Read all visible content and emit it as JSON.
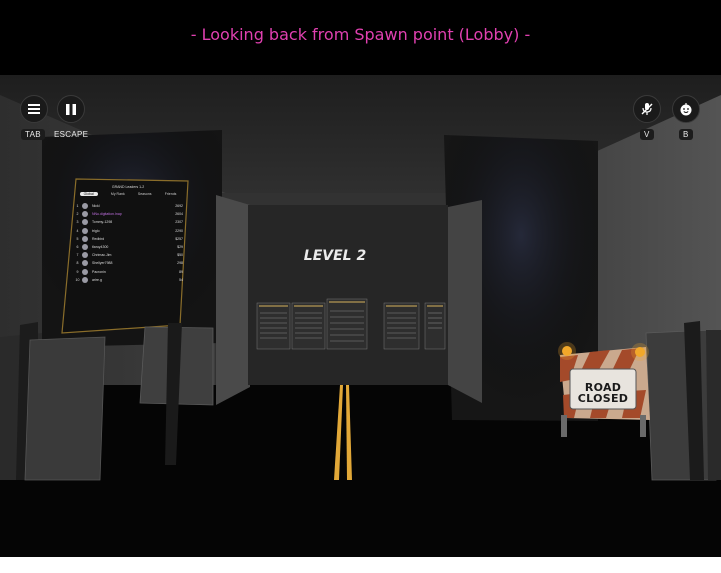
{
  "caption": "- Looking back from Spawn point (Lobby) -",
  "hud": {
    "menu_key": "TAB",
    "pause_key": "ESCAPE",
    "mic_key": "V",
    "emote_key": "B"
  },
  "level_sign": "LEVEL 2",
  "leaderboard": {
    "title": "GRAND Leaders 1-2",
    "tabs": [
      "Global",
      "My Rank",
      "Seasons",
      "Friends"
    ],
    "rows": [
      {
        "rank": "1",
        "name": "Nickl",
        "score": "2692"
      },
      {
        "rank": "2",
        "name": "NNu.digitation.Inap",
        "score": "2604"
      },
      {
        "rank": "3",
        "name": "Tommy-1298",
        "score": "2307"
      },
      {
        "rank": "4",
        "name": "triglo",
        "score": "2290"
      },
      {
        "rank": "5",
        "name": "Redbird",
        "score": "$257"
      },
      {
        "rank": "6",
        "name": "tlaruy4300",
        "score": "$29"
      },
      {
        "rank": "7",
        "name": "Chrimac.Jim",
        "score": "$50"
      },
      {
        "rank": "8",
        "name": "Shellyer7988",
        "score": "298"
      },
      {
        "rank": "9",
        "name": "Pacronin",
        "score": "89"
      },
      {
        "rank": "10",
        "name": "arire.g",
        "score": "54"
      }
    ]
  },
  "road_sign": {
    "line1": "ROAD",
    "line2": "CLOSED"
  },
  "colors": {
    "caption": "#e040b0",
    "background": "#000000",
    "road_line": "#e2a838"
  }
}
